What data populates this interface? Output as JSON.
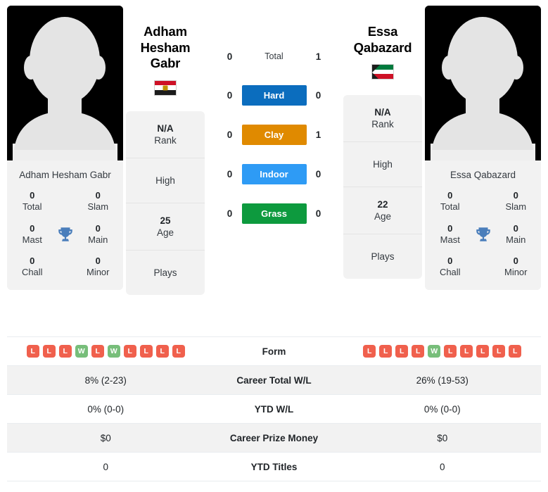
{
  "players": {
    "left": {
      "name_line1": "Adham",
      "name_line2": "Hesham Gabr",
      "full_name": "Adham Hesham Gabr",
      "country": "Egypt",
      "flag_icon": "flag-egypt-icon",
      "avatar_icon": "player-avatar-placeholder-icon",
      "rank": "N/A",
      "rank_label": "Rank",
      "high_label": "High",
      "age": "25",
      "age_label": "Age",
      "plays_label": "Plays",
      "titles": {
        "total": "0",
        "total_label": "Total",
        "slam": "0",
        "slam_label": "Slam",
        "mast": "0",
        "mast_label": "Mast",
        "main": "0",
        "main_label": "Main",
        "chall": "0",
        "chall_label": "Chall",
        "minor": "0",
        "minor_label": "Minor"
      },
      "form": [
        "L",
        "L",
        "L",
        "W",
        "L",
        "W",
        "L",
        "L",
        "L",
        "L"
      ],
      "career_total_wl": "8% (2-23)",
      "ytd_wl": "0% (0-0)",
      "career_prize_money": "$0",
      "ytd_titles": "0"
    },
    "right": {
      "name_line1": "Essa",
      "name_line2": "Qabazard",
      "full_name": "Essa Qabazard",
      "country": "Kuwait",
      "flag_icon": "flag-kuwait-icon",
      "avatar_icon": "player-avatar-placeholder-icon",
      "rank": "N/A",
      "rank_label": "Rank",
      "high_label": "High",
      "age": "22",
      "age_label": "Age",
      "plays_label": "Plays",
      "titles": {
        "total": "0",
        "total_label": "Total",
        "slam": "0",
        "slam_label": "Slam",
        "mast": "0",
        "mast_label": "Mast",
        "main": "0",
        "main_label": "Main",
        "chall": "0",
        "chall_label": "Chall",
        "minor": "0",
        "minor_label": "Minor"
      },
      "form": [
        "L",
        "L",
        "L",
        "L",
        "W",
        "L",
        "L",
        "L",
        "L",
        "L"
      ],
      "career_total_wl": "26% (19-53)",
      "ytd_wl": "0% (0-0)",
      "career_prize_money": "$0",
      "ytd_titles": "0"
    }
  },
  "head_to_head": [
    {
      "label": "Total",
      "left": "0",
      "right": "1",
      "color": "",
      "style": "plain"
    },
    {
      "label": "Hard",
      "left": "0",
      "right": "0",
      "color": "#0b6dbe",
      "style": "badge"
    },
    {
      "label": "Clay",
      "left": "0",
      "right": "1",
      "color": "#e08a00",
      "style": "badge"
    },
    {
      "label": "Indoor",
      "left": "0",
      "right": "0",
      "color": "#2e9bf5",
      "style": "badge"
    },
    {
      "label": "Grass",
      "left": "0",
      "right": "0",
      "color": "#0d9a3e",
      "style": "badge"
    }
  ],
  "stats_table": {
    "rows": [
      {
        "label": "Form",
        "type": "form",
        "left": "",
        "right": ""
      },
      {
        "label": "Career Total W/L",
        "type": "text",
        "left": "8% (2-23)",
        "right": "26% (19-53)"
      },
      {
        "label": "YTD W/L",
        "type": "text",
        "left": "0% (0-0)",
        "right": "0% (0-0)"
      },
      {
        "label": "Career Prize Money",
        "type": "text",
        "left": "$0",
        "right": "$0"
      },
      {
        "label": "YTD Titles",
        "type": "text",
        "left": "0",
        "right": "0"
      }
    ]
  },
  "colors": {
    "hard": "#0b6dbe",
    "clay": "#e08a00",
    "indoor": "#2e9bf5",
    "grass": "#0d9a3e",
    "win": "#77be7a",
    "loss": "#f0604d",
    "card_bg": "#f2f2f2",
    "trophy": "#4a7ebb"
  }
}
